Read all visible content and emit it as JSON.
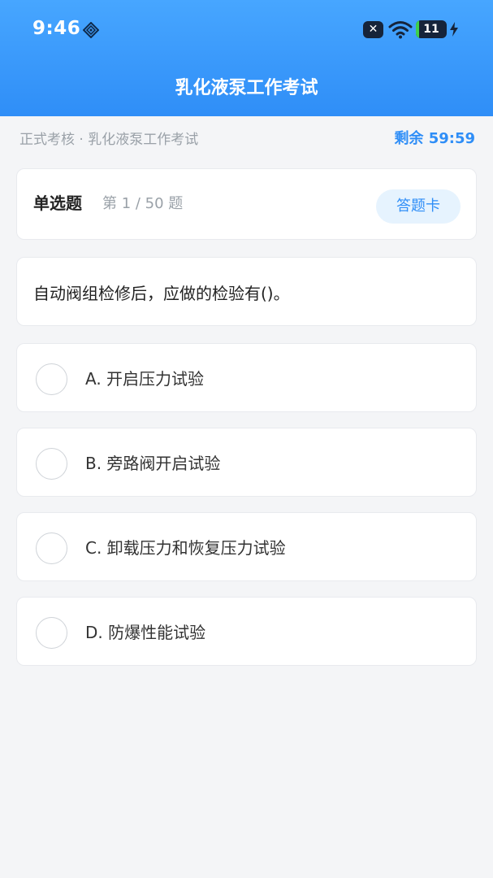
{
  "status_bar": {
    "time": "9:46",
    "battery": "11",
    "battery_level": 0.11
  },
  "header": {
    "title": "乳化液泵工作考试"
  },
  "crumb": "正式考核 · 乳化液泵工作考试",
  "timer": "剩余 59:59",
  "question_header": {
    "type": "单选题",
    "progress": "第 1 / 50 题",
    "answer_card_button": "答题卡"
  },
  "question": {
    "text": "自动阀组检修后，应做的检验有()。"
  },
  "options": [
    {
      "label": "A. 开启压力试验"
    },
    {
      "label": "B. 旁路阀开启试验"
    },
    {
      "label": "C. 卸载压力和恢复压力试验"
    },
    {
      "label": "D. 防爆性能试验"
    }
  ],
  "icons": {
    "status_left": "diamond-icon",
    "status_right": [
      "close-icon",
      "wifi-icon",
      "battery-icon",
      "charging-bolt-icon"
    ],
    "option_selector": "radio-circle"
  },
  "colors": {
    "accent": "#2f8ef7",
    "header_gradient_top": "#47a6ff",
    "background": "#f4f5f7"
  }
}
